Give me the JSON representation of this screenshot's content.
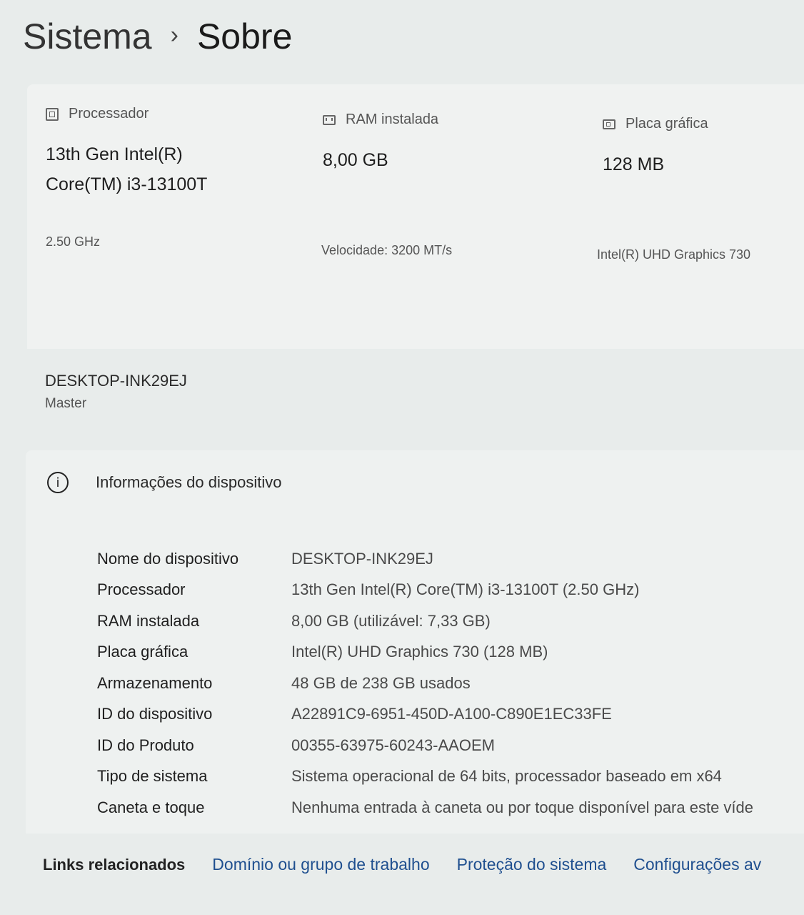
{
  "breadcrumb": {
    "parent": "Sistema",
    "separator": "›",
    "current": "Sobre"
  },
  "specs": {
    "processor": {
      "icon": "processor-icon",
      "label": "Processador",
      "value_line1": "13th Gen Intel(R)",
      "value_line2": "Core(TM) i3-13100T",
      "detail": "2.50 GHz"
    },
    "ram": {
      "icon": "ram-icon",
      "label": "RAM instalada",
      "value": "8,00 GB",
      "detail": "Velocidade: 3200 MT/s"
    },
    "gpu": {
      "icon": "graphics-card-icon",
      "label": "Placa gráfica",
      "value": "128 MB",
      "detail": "Intel(R) UHD Graphics 730"
    }
  },
  "device": {
    "name": "DESKTOP-INK29EJ",
    "owner": "Master"
  },
  "info": {
    "icon": "info-icon",
    "title": "Informações do dispositivo",
    "rows": [
      {
        "label": "Nome do dispositivo",
        "value": "DESKTOP-INK29EJ"
      },
      {
        "label": "Processador",
        "value": "13th Gen Intel(R) Core(TM) i3-13100T (2.50 GHz)"
      },
      {
        "label": "RAM instalada",
        "value": "8,00 GB (utilizável: 7,33 GB)"
      },
      {
        "label": "Placa gráfica",
        "value": "Intel(R) UHD Graphics 730 (128 MB)"
      },
      {
        "label": "Armazenamento",
        "value": "48 GB de 238 GB usados"
      },
      {
        "label": "ID do dispositivo",
        "value": "A22891C9-6951-450D-A100-C890E1EC33FE"
      },
      {
        "label": "ID do Produto",
        "value": "00355-63975-60243-AAOEM"
      },
      {
        "label": "Tipo de sistema",
        "value": "Sistema operacional de 64 bits, processador baseado em x64"
      },
      {
        "label": "Caneta e toque",
        "value": "Nenhuma entrada à caneta ou por toque disponível para este víde"
      }
    ]
  },
  "related_links": {
    "title": "Links relacionados",
    "items": [
      "Domínio ou grupo de trabalho",
      "Proteção do sistema",
      "Configurações av"
    ]
  }
}
